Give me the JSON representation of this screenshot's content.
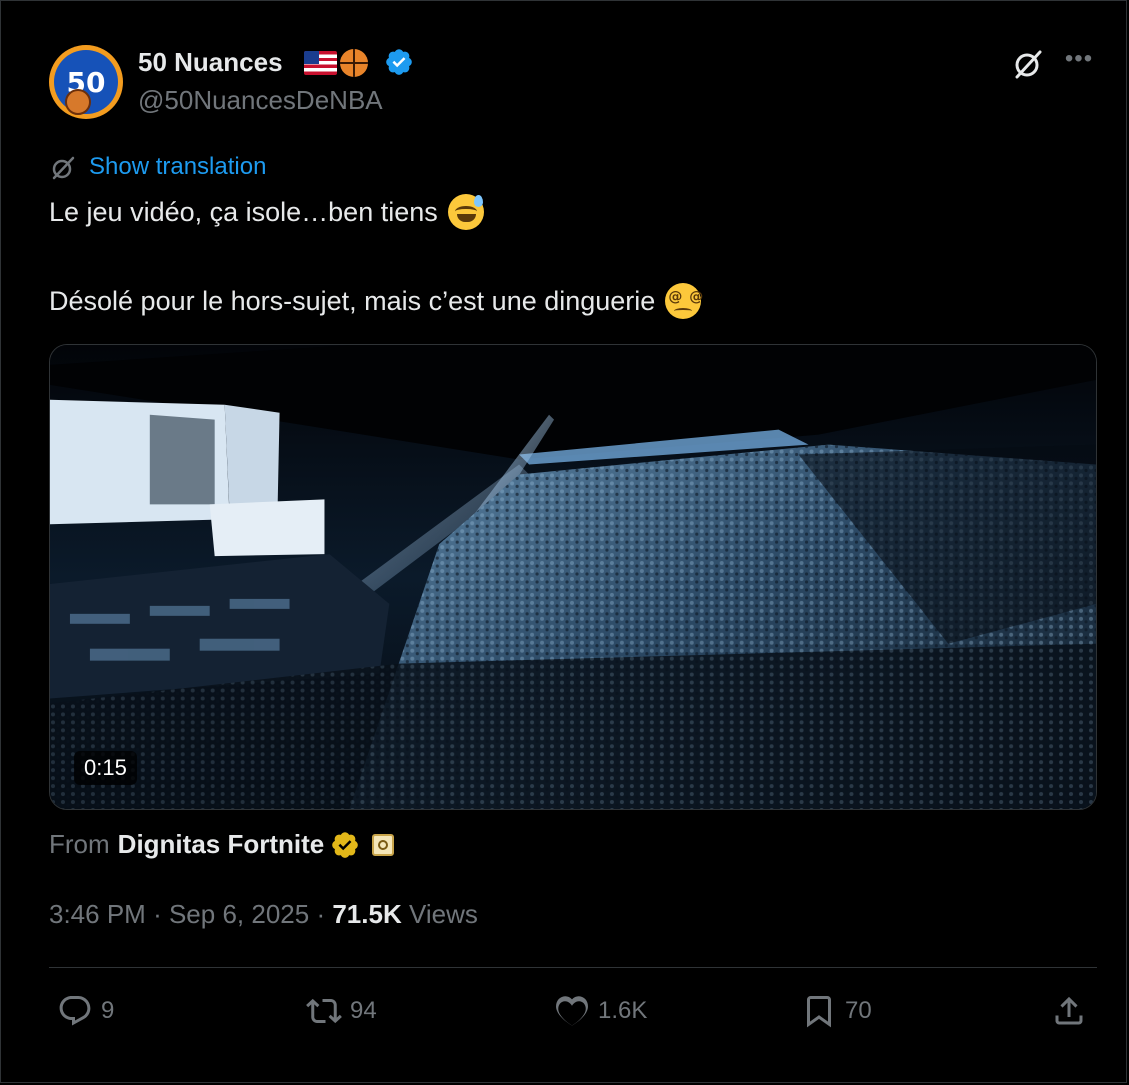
{
  "author": {
    "display_name": "50 Nuances",
    "handle": "@50NuancesDeNBA",
    "avatar_text": "50",
    "emojis": [
      "us-flag",
      "basketball"
    ],
    "verified": true
  },
  "translation": {
    "label": "Show translation"
  },
  "tweet": {
    "line1": "Le jeu vidéo, ça isole…ben tiens",
    "line1_emoji": "grinning-face-with-sweat",
    "line2": "Désolé pour le hors-sujet, mais c’est une dinguerie",
    "line2_emoji": "face-with-spiral-eyes"
  },
  "media": {
    "type": "video",
    "duration": "0:15"
  },
  "source": {
    "from_label": "From",
    "name": "Dignitas Fortnite",
    "badge": "gold-verified"
  },
  "meta": {
    "time": "3:46 PM",
    "separator": "·",
    "date": "Sep 6, 2025",
    "views_count": "71.5K",
    "views_label": "Views"
  },
  "actions": {
    "replies": "9",
    "reposts": "94",
    "likes": "1.6K",
    "bookmarks": "70"
  },
  "colors": {
    "background": "#000000",
    "text": "#e7e9ea",
    "secondary": "#71767b",
    "link": "#1d9bf0",
    "verified_blue": "#1d9bf0",
    "verified_gold": "#e2b719"
  }
}
